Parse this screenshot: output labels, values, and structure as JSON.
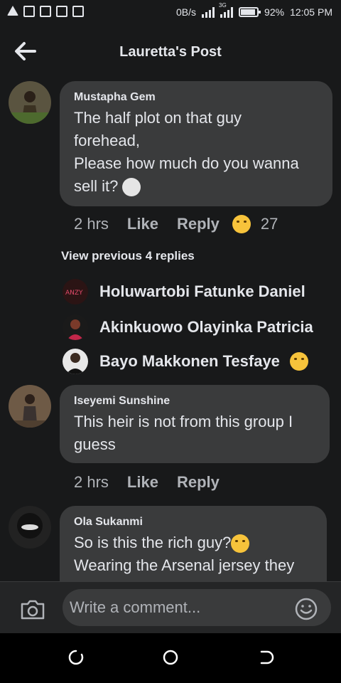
{
  "status_bar": {
    "network_speed": "0B/s",
    "network_type": "3G",
    "battery_percent": "92%",
    "battery_level": 0.92,
    "time": "12:05 PM",
    "icons": [
      "alert-triangle-icon",
      "notes-icon",
      "cast-icon",
      "battery-saver-icon",
      "activity-icon",
      "signal-icon",
      "signal-3g-icon",
      "battery-icon"
    ]
  },
  "header": {
    "title": "Lauretta's Post",
    "back_icon": "back-arrow-icon"
  },
  "comments": [
    {
      "author": "Mustapha Gem",
      "lines": [
        "The half plot on that guy",
        "forehead,",
        "Please how much do you wanna",
        "sell it?"
      ],
      "trailing_emoji": "full-moon-face-emoji",
      "time": "2 hrs",
      "like_label": "Like",
      "reply_label": "Reply",
      "reaction_emoji": "laughing-face-emoji",
      "reaction_count": "27"
    },
    {
      "author": "Iseyemi Sunshine",
      "lines": [
        "This heir is not from this group I",
        "guess"
      ],
      "time": "2 hrs",
      "like_label": "Like",
      "reply_label": "Reply"
    },
    {
      "author": "Ola Sukanmi",
      "lines": [
        "So is this the rich guy?",
        "Wearing the Arsenal jersey they"
      ],
      "trailing_emoji": "unamused-face-emoji"
    }
  ],
  "replies": {
    "view_previous_label": "View previous 4 replies",
    "items": [
      {
        "name": "Holuwartobi Fatunke Daniel"
      },
      {
        "name": "Akinkuowo Olayinka Patricia"
      },
      {
        "name": "Bayo Makkonen Tesfaye",
        "emoji": "tears-of-joy-emoji"
      }
    ]
  },
  "comment_bar": {
    "placeholder": "Write a comment...",
    "camera_icon": "camera-icon",
    "emoji_icon": "smile-icon"
  },
  "nav_bar": {
    "icons": [
      "recent-apps-icon",
      "home-icon",
      "back-icon"
    ]
  }
}
